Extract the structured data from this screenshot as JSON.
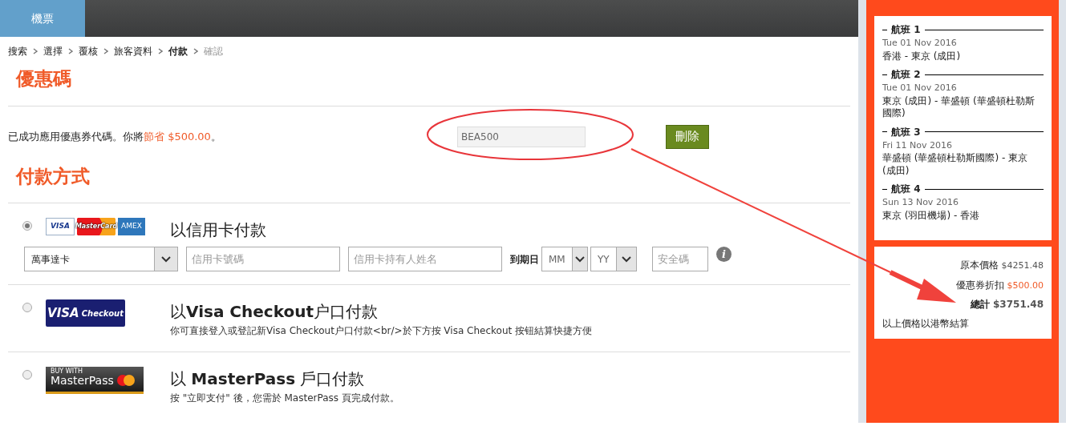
{
  "top_nav": {
    "tabs": [
      {
        "label": "機票",
        "selected": true
      }
    ]
  },
  "breadcrumb": [
    {
      "label": "搜索",
      "kind": "done"
    },
    {
      "label": "選擇",
      "kind": "done"
    },
    {
      "label": "覆核",
      "kind": "done"
    },
    {
      "label": "旅客資料",
      "kind": "done"
    },
    {
      "label": "付款",
      "kind": "current"
    },
    {
      "label": "確認",
      "kind": "upcoming"
    }
  ],
  "promo": {
    "heading": "優惠碼",
    "message": "已成功應用優惠券代碼。你將",
    "savings": "節省 $500.00",
    "message_end": "。",
    "code": "BEA500",
    "remove_button": "刪除"
  },
  "payment": {
    "heading": "付款方式",
    "options": [
      {
        "kind": "card",
        "selected": true,
        "title": "以信用卡付款",
        "logos": [
          {
            "kind": "visa",
            "text": "VISA"
          },
          {
            "kind": "mastercard",
            "text": "MasterCard"
          },
          {
            "kind": "amex",
            "text": "AMEX"
          }
        ],
        "card_type": "萬事達卡",
        "card_number_placeholder": "信用卡號碼",
        "holder_placeholder": "信用卡持有人姓名",
        "expiry_label": "到期日",
        "month": "MM",
        "year": "YY",
        "cvv_placeholder": "安全碼",
        "info": "i"
      },
      {
        "kind": "visa_checkout",
        "selected": false,
        "title": "以**Visa Checkout**户口付款",
        "logos": [
          {
            "kind": "visa_checkout",
            "text": "VISA",
            "sub": "Checkout"
          }
        ],
        "description": "你可直接登入或登記新Visa Checkout户口付款<br/>於下方按 Visa Checkout 按钮結算快捷方便"
      },
      {
        "kind": "masterpass",
        "selected": false,
        "title": "以 **MasterPass** 戶口付款",
        "logos": [
          {
            "kind": "masterpass",
            "text": "MasterPass",
            "sub": "BUY WITH"
          }
        ],
        "description": "按 \"立即支付\" 後，您需於 MasterPass 頁完成付款。"
      }
    ]
  },
  "summary": {
    "flights": [
      {
        "label": "航班 1",
        "date": "Tue 01 Nov 2016",
        "route": "香港 - 東京 (成田)"
      },
      {
        "label": "航班 2",
        "date": "Tue 01 Nov 2016",
        "route": "東京 (成田) - 華盛頓 (華盛頓杜勒斯國際)"
      },
      {
        "label": "航班 3",
        "date": "Fri 11 Nov 2016",
        "route": "華盛頓 (華盛頓杜勒斯國際) - 東京 (成田)"
      },
      {
        "label": "航班 4",
        "date": "Sun 13 Nov 2016",
        "route": "東京 (羽田機場) - 香港"
      }
    ],
    "prices": [
      {
        "kind": "normal",
        "label": "原本價格",
        "value": "$4251.48"
      },
      {
        "kind": "discount",
        "label": "優惠券折扣",
        "value": "$500.00"
      },
      {
        "kind": "total",
        "label": "總計",
        "value": "$3751.48"
      }
    ],
    "note": "以上價格以港幣結算"
  },
  "annotations": {
    "ellipse": true,
    "arrow": true
  }
}
